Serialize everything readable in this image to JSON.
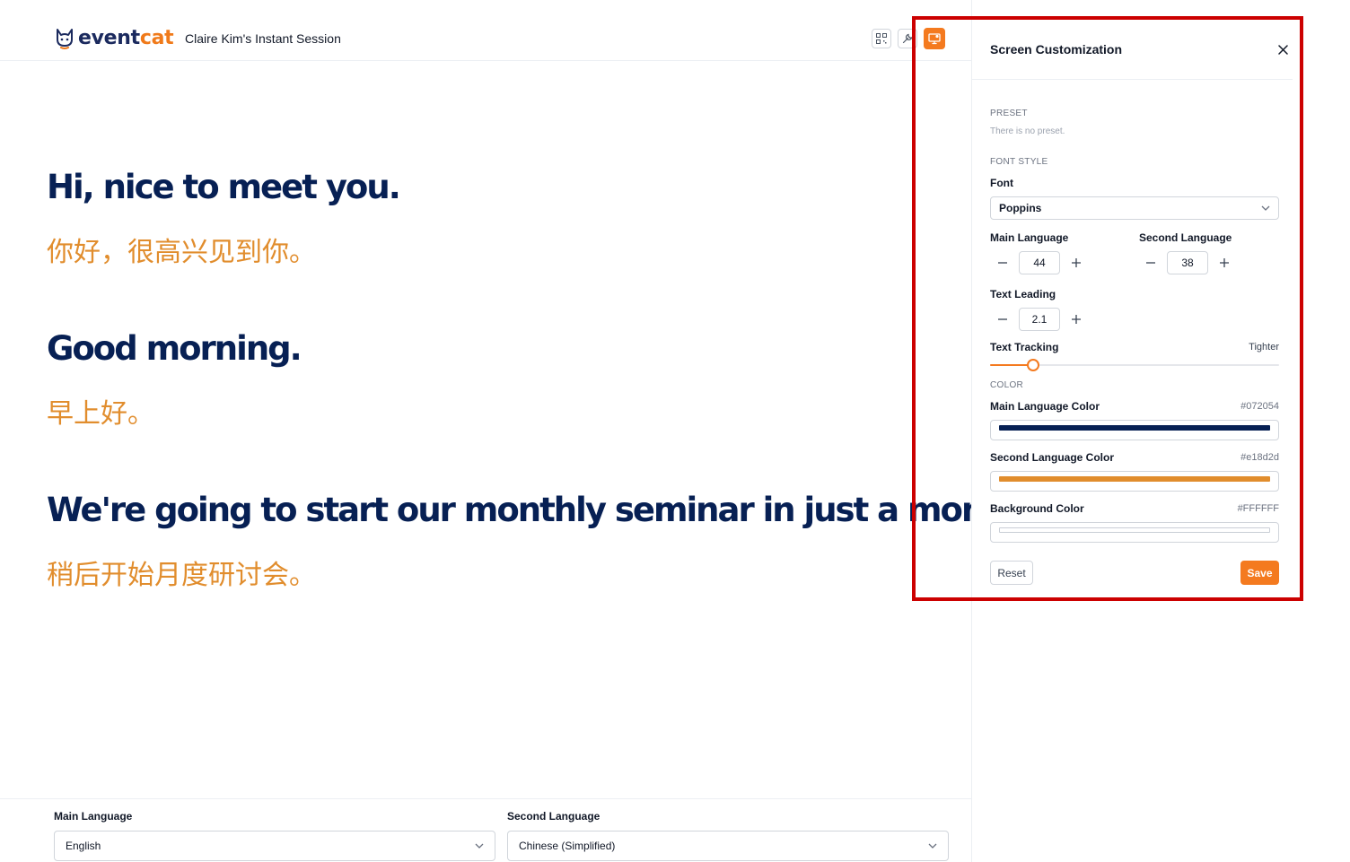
{
  "header": {
    "logo": {
      "part1": "event",
      "part2": "cat"
    },
    "session_title": "Claire Kim's Instant Session",
    "icons": {
      "qr": "qr-code-icon",
      "wrench": "wrench-icon",
      "screen": "screen-settings-icon"
    }
  },
  "transcript": [
    {
      "main": "Hi, nice to meet you.",
      "second": "你好，很高兴见到你。"
    },
    {
      "main": "Good morning.",
      "second": "早上好。"
    },
    {
      "main": "We're going to start our monthly seminar in just a moment.",
      "second": "稍后开始月度研讨会。"
    }
  ],
  "bottom": {
    "main_language": {
      "label": "Main Language",
      "value": "English"
    },
    "second_language": {
      "label": "Second Language",
      "value": "Chinese (Simplified)"
    }
  },
  "panel": {
    "title": "Screen Customization",
    "preset": {
      "label": "PRESET",
      "hint": "There is no preset."
    },
    "font_style": {
      "label": "FONT STYLE",
      "font_label": "Font",
      "font_value": "Poppins",
      "main_size_label": "Main Language",
      "main_size": "44",
      "second_size_label": "Second Language",
      "second_size": "38",
      "leading_label": "Text Leading",
      "leading": "2.1",
      "tracking_label": "Text Tracking",
      "tracking_value": "Tighter",
      "tracking_level": 0.15
    },
    "color": {
      "label": "COLOR",
      "main_label": "Main Language Color",
      "main_value": "#072054",
      "second_label": "Second Language Color",
      "second_value": "#e18d2d",
      "bg_label": "Background Color",
      "bg_value": "#FFFFFF"
    },
    "reset_label": "Reset",
    "save_label": "Save"
  },
  "colors": {
    "accent": "#f47a1f",
    "main_text": "#072054",
    "second_text": "#e18d2d",
    "highlight": "#cc0000"
  }
}
